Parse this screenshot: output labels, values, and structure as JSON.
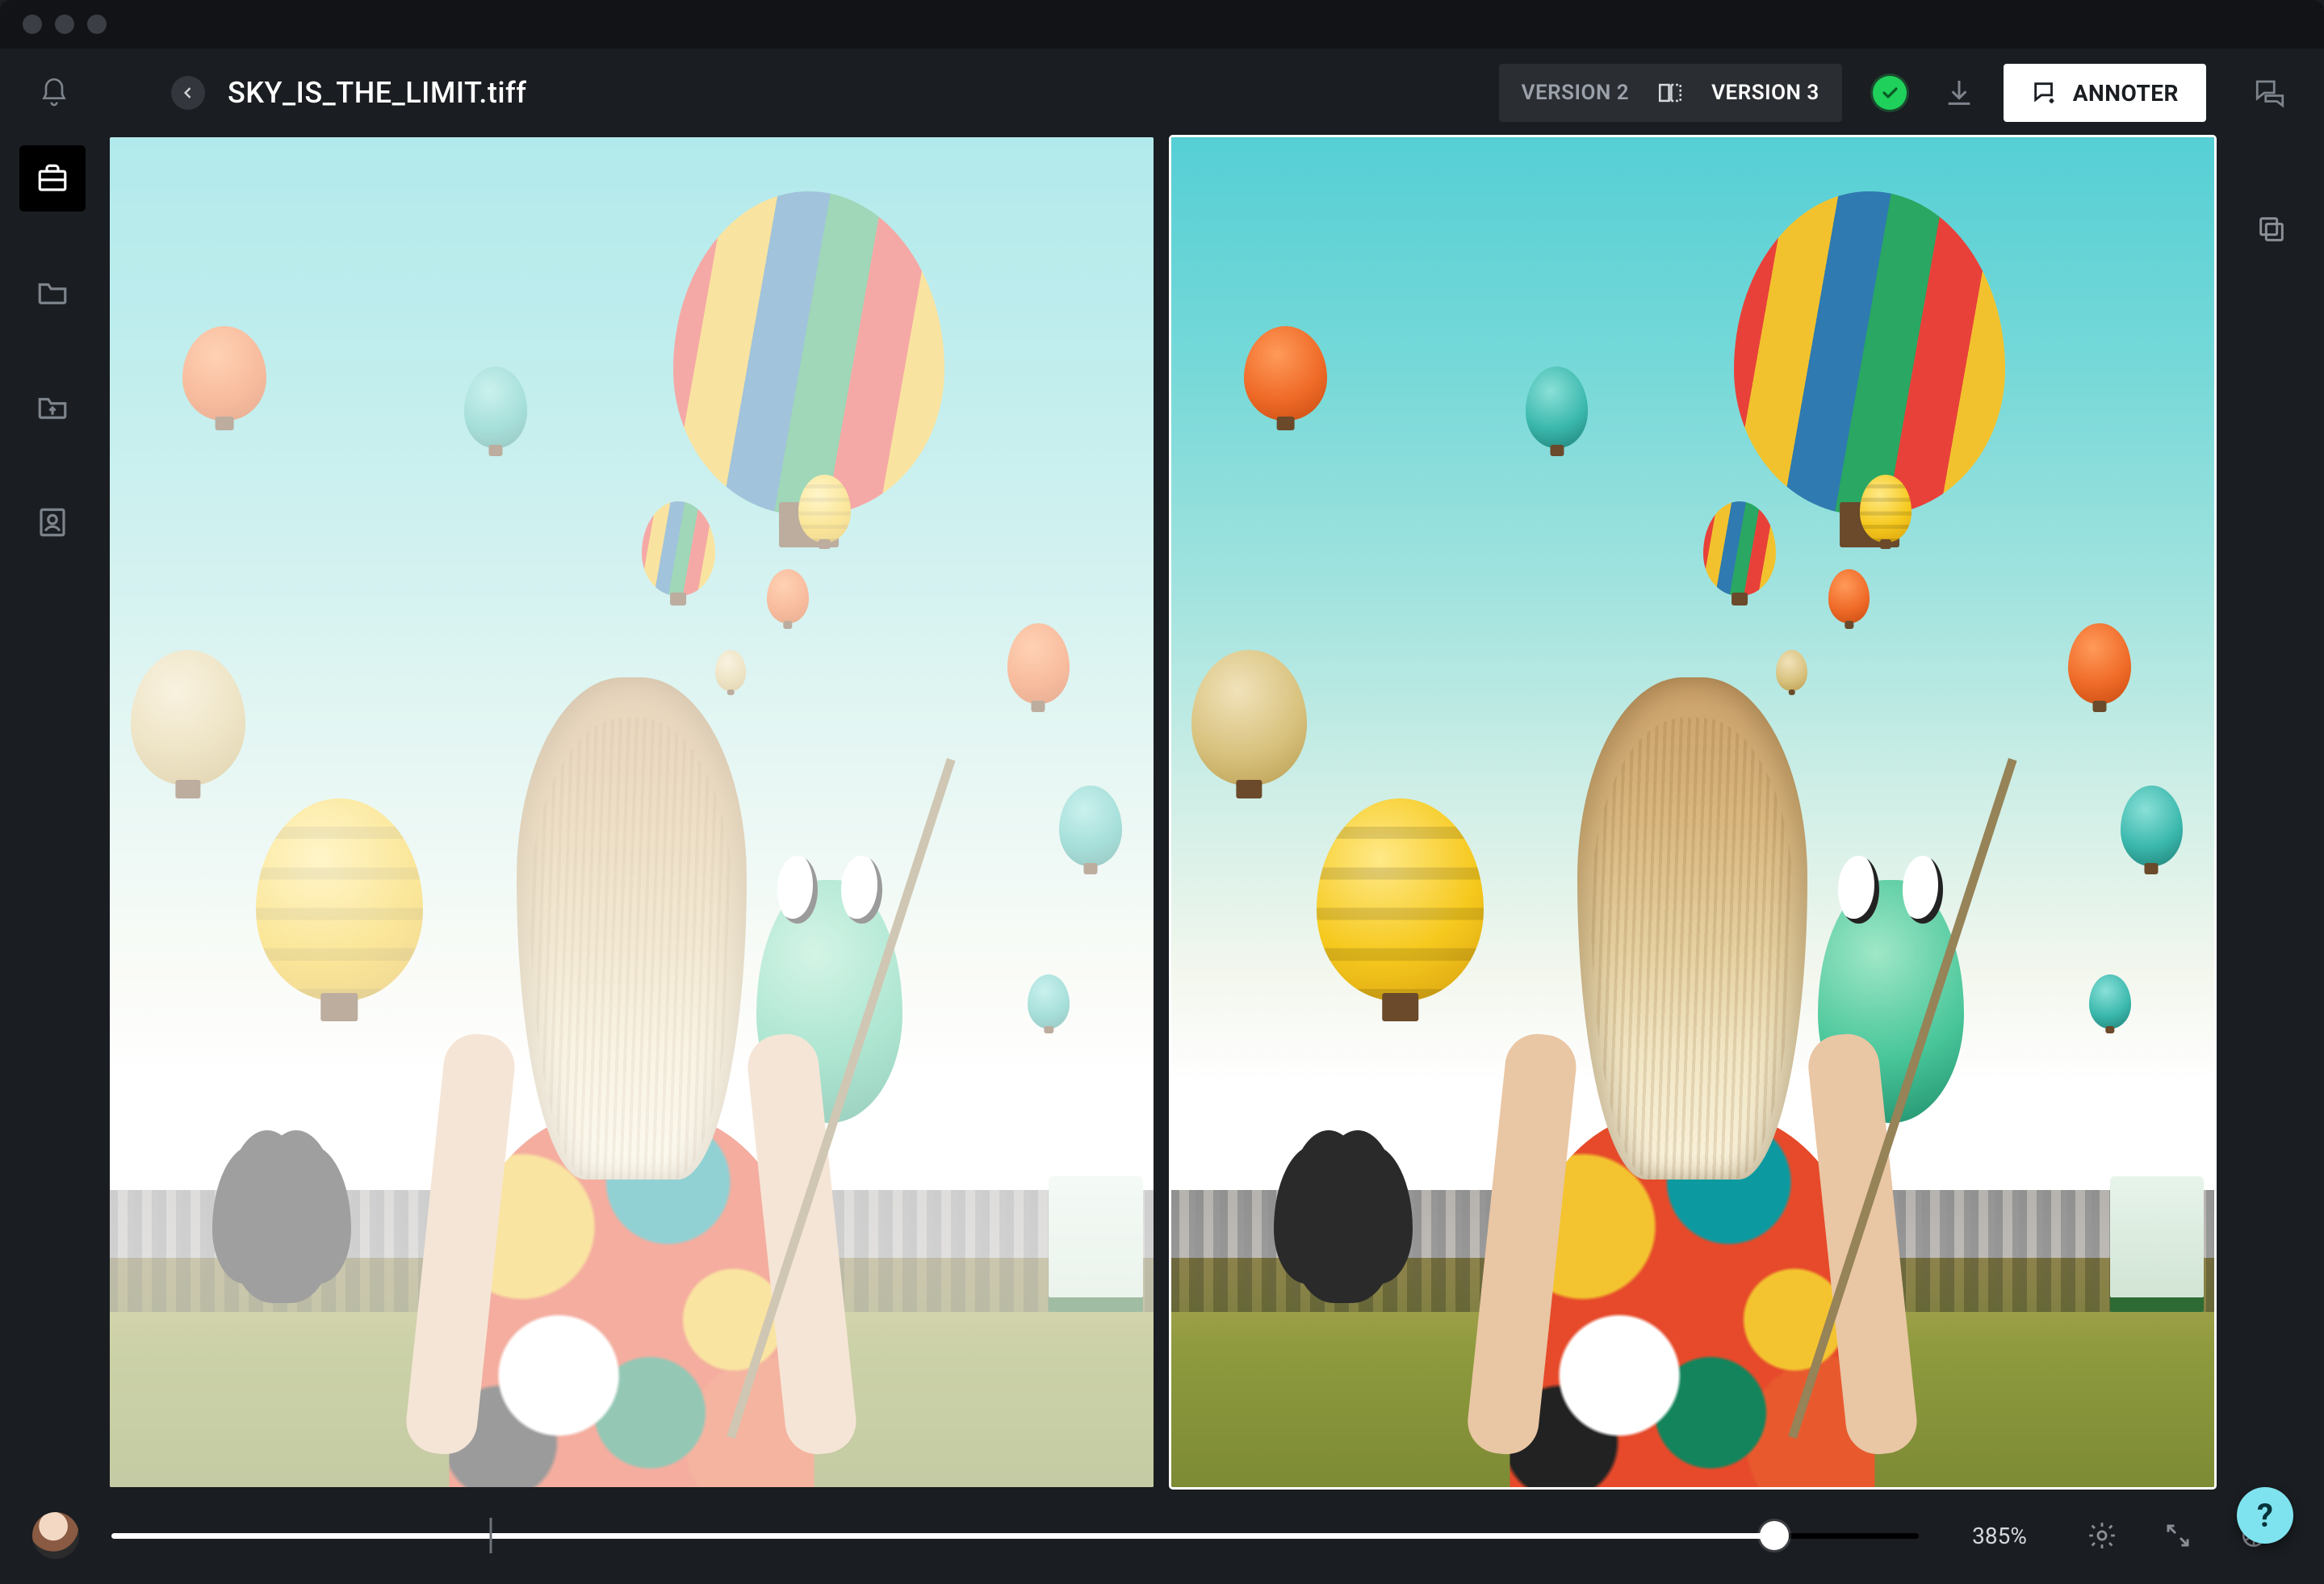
{
  "file": {
    "name": "SKY_IS_THE_LIMIT.tiff"
  },
  "versions": {
    "left": "VERSION 2",
    "right": "VERSION 3"
  },
  "actions": {
    "annotate": "ANNOTER"
  },
  "status": {
    "approved": true
  },
  "footer": {
    "zoom": "385%"
  },
  "sidebar_left": {
    "items": [
      "toolbox",
      "folder",
      "archive",
      "contact"
    ],
    "active_index": 0
  },
  "sidebar_right": {
    "items": [
      "comments",
      "duplicate"
    ]
  },
  "help": {
    "label": "?"
  },
  "colors": {
    "accent_green": "#1fd05a",
    "help_bg": "#7fe3ef",
    "bg": "#1a1d21"
  }
}
